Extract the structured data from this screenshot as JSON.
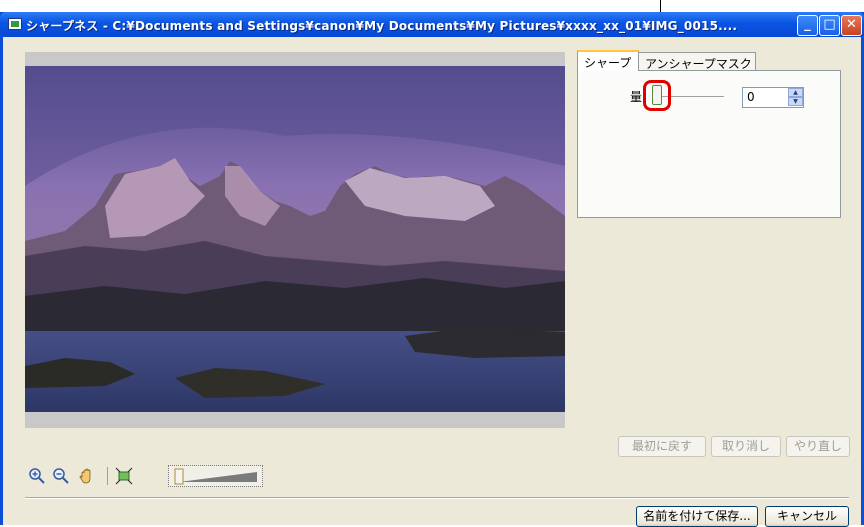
{
  "window": {
    "title": "シャープネス - C:¥Documents and Settings¥canon¥My Documents¥My Pictures¥xxxx_xx_01¥IMG_0015....",
    "controls": [
      "_",
      "□",
      "✕"
    ]
  },
  "tabs": [
    {
      "label": "シャープ"
    },
    {
      "label": "アンシャープマスク"
    }
  ],
  "sharp": {
    "amount_label": "量",
    "amount_value": "0",
    "slider_level": 0
  },
  "buttons": {
    "reset": "最初に戻す",
    "undo": "取り消し",
    "redo": "やり直し",
    "save_as": "名前を付けて保存...",
    "cancel": "キャンセル"
  },
  "icons": [
    "zoom-in-icon",
    "zoom-out-icon",
    "hand-icon",
    "fit-to-window-icon"
  ],
  "colors": {
    "titlebar": "#0a54e2",
    "highlight": "#e00000",
    "window_bg": "#ece9d8"
  }
}
